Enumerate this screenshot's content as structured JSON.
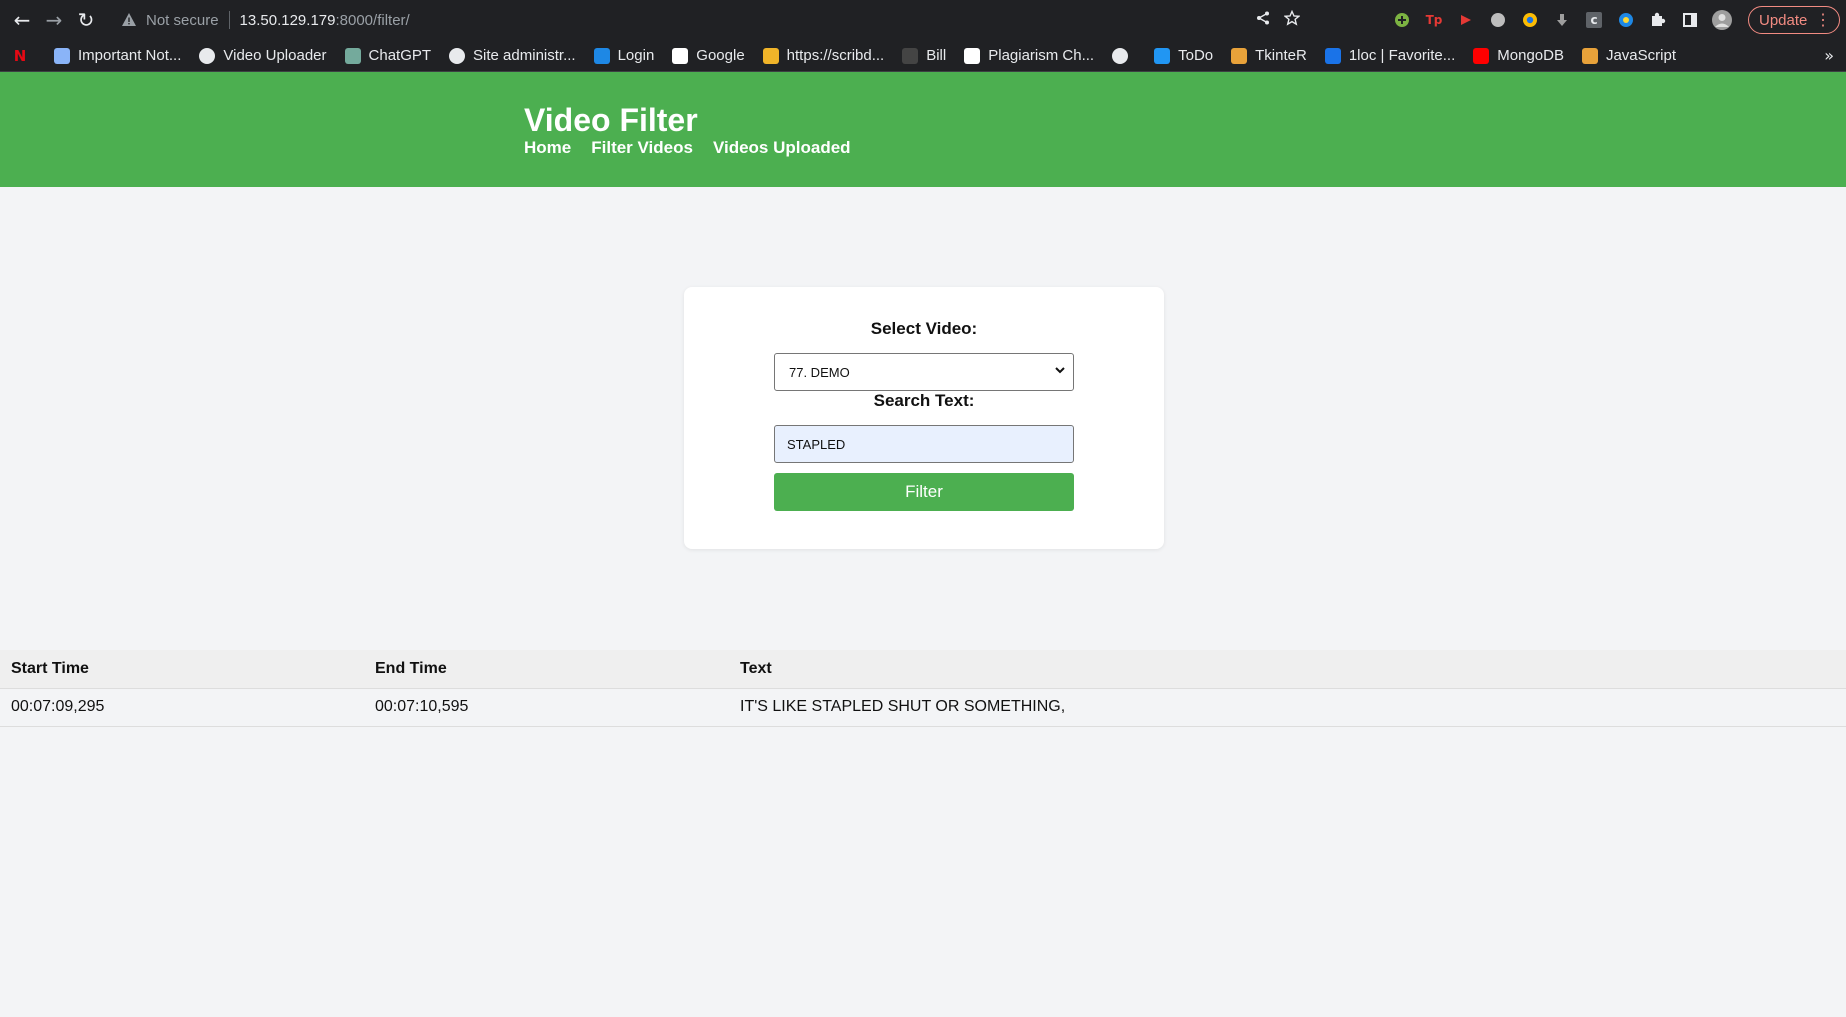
{
  "browser": {
    "not_secure": "Not secure",
    "url_host": "13.50.129.179",
    "url_path": ":8000/filter/",
    "update_label": "Update",
    "bookmarks": [
      {
        "label": "",
        "icon": "netflix-icon",
        "color": "#e50914"
      },
      {
        "label": "Important Not...",
        "icon": "notes-icon",
        "color": "#8ab4f8"
      },
      {
        "label": "Video Uploader",
        "icon": "globe-icon",
        "color": "#e8eaed"
      },
      {
        "label": "ChatGPT",
        "icon": "chatgpt-icon",
        "color": "#74aa9c"
      },
      {
        "label": "Site administr...",
        "icon": "globe-icon",
        "color": "#e8eaed"
      },
      {
        "label": "Login",
        "icon": "arrow-icon",
        "color": "#1e88e5"
      },
      {
        "label": "Google",
        "icon": "google-icon",
        "color": "#ffffff"
      },
      {
        "label": "https://scribd...",
        "icon": "scribd-icon",
        "color": "#f0b429"
      },
      {
        "label": "Bill",
        "icon": "bill-icon",
        "color": "#444444"
      },
      {
        "label": "Plagiarism Ch...",
        "icon": "plagiarism-icon",
        "color": "#ffffff"
      },
      {
        "label": "",
        "icon": "globe-icon",
        "color": "#e8eaed"
      },
      {
        "label": "ToDo",
        "icon": "todo-icon",
        "color": "#2196f3"
      },
      {
        "label": "TkinteR",
        "icon": "tkinter-icon",
        "color": "#e8a23a"
      },
      {
        "label": "1loc | Favorite...",
        "icon": "1loc-icon",
        "color": "#1a73e8"
      },
      {
        "label": "MongoDB",
        "icon": "youtube-icon",
        "color": "#ff0000"
      },
      {
        "label": "JavaScript",
        "icon": "javascript-icon",
        "color": "#e8a23a"
      }
    ],
    "more_bookmarks": "»"
  },
  "header": {
    "title": "Video Filter",
    "nav": [
      "Home",
      "Filter Videos",
      "Videos Uploaded"
    ]
  },
  "form": {
    "select_label": "Select Video:",
    "selected_video": "77. DEMO",
    "search_label": "Search Text:",
    "search_value": "STAPLED",
    "filter_button": "Filter"
  },
  "results": {
    "columns": [
      "Start Time",
      "End Time",
      "Text"
    ],
    "rows": [
      {
        "start": "00:07:09,295",
        "end": "00:07:10,595",
        "text": "IT'S LIKE STAPLED SHUT OR SOMETHING,"
      }
    ]
  },
  "colors": {
    "accent": "#4caf50",
    "page_bg": "#f3f4f6",
    "input_autofill": "#e8f0fe"
  }
}
